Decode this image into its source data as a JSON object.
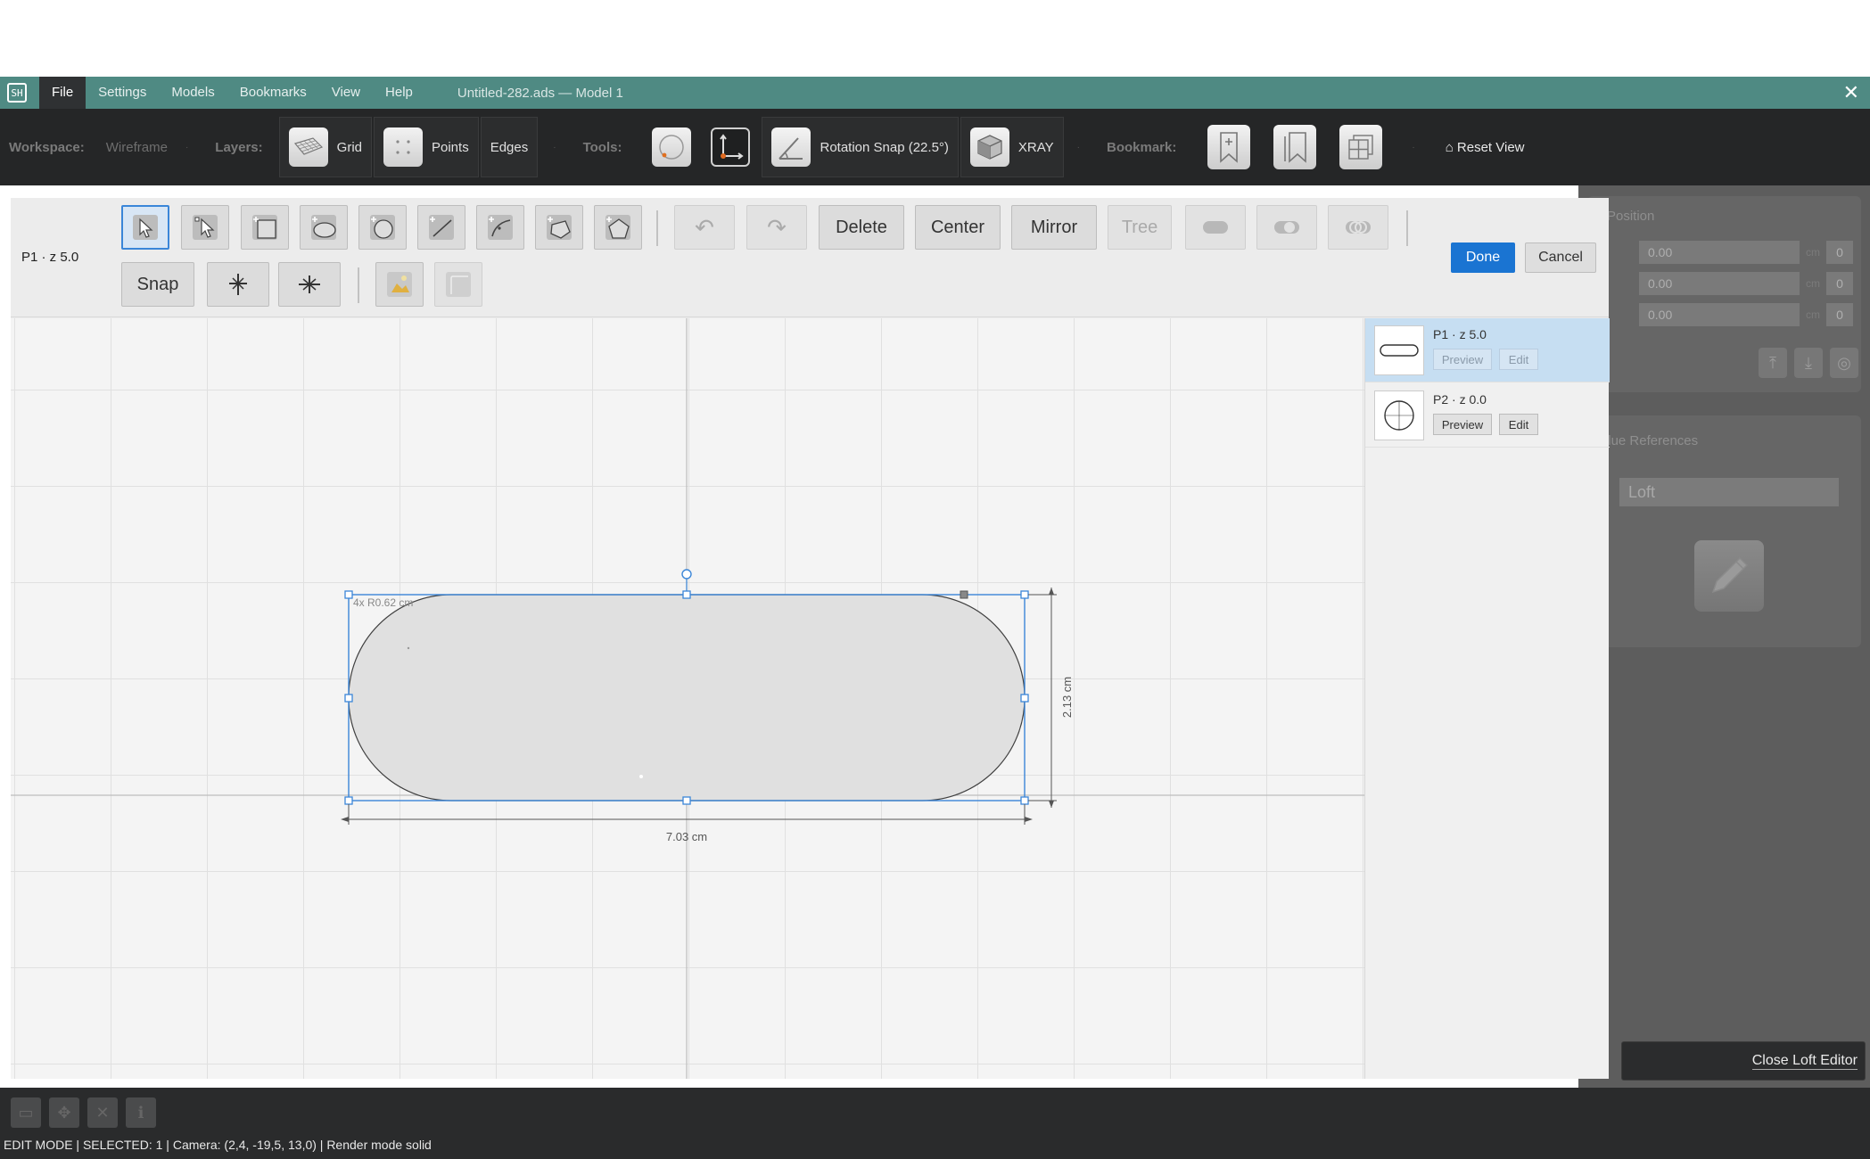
{
  "app": {
    "icon_text": "SH",
    "document_title": "Untitled-282.ads — Model 1",
    "close_glyph": "✕"
  },
  "menu": {
    "items": [
      "File",
      "Settings",
      "Models",
      "Bookmarks",
      "View",
      "Help"
    ],
    "active": "File"
  },
  "toolbar": {
    "workspace_label": "Workspace:",
    "workspace_value": "Wireframe",
    "layers_label": "Layers:",
    "grid_label": "Grid",
    "points_label": "Points",
    "edges_label": "Edges",
    "tools_label": "Tools:",
    "rotation_snap_label": "Rotation Snap (22.5°)",
    "xray_label": "XRAY",
    "bookmark_label": "Bookmark:",
    "reset_view_label": "⌂ Reset View",
    "separator": "·"
  },
  "editor": {
    "layer_label": "P1 · z 5.0",
    "delete_label": "Delete",
    "center_label": "Center",
    "mirror_label": "Mirror",
    "tree_label": "Tree",
    "snap_label": "Snap",
    "done_label": "Done",
    "cancel_label": "Cancel",
    "undo_glyph": "↶",
    "redo_glyph": "↷",
    "canvas": {
      "corner_label": "4x R0.62 cm",
      "width_label": "7.03 cm",
      "height_label": "2.13 cm"
    },
    "layers": [
      {
        "name": "P1 · z 5.0",
        "preview": "Preview",
        "edit": "Edit",
        "shape": "rounded-rect-icon",
        "active": true
      },
      {
        "name": "P2 · z 0.0",
        "preview": "Preview",
        "edit": "Edit",
        "shape": "circle-icon",
        "active": false
      }
    ]
  },
  "right_panel": {
    "position_title": "Position",
    "rows": [
      {
        "value": "0.00",
        "unit": "cm",
        "extra": "0"
      },
      {
        "value": "0.00",
        "unit": "cm",
        "extra": "0"
      },
      {
        "value": "0.00",
        "unit": "cm",
        "extra": "0"
      }
    ],
    "value_references_title": "Value References",
    "loft_label": "Loft",
    "close_loft_label": "Close Loft Editor"
  },
  "status_bar": {
    "text": "EDIT MODE | SELECTED: 1 | Camera: (2,4, -19,5, 13,0) | Render mode solid"
  },
  "colors": {
    "menubar": "#4f8a83",
    "toolbar": "#252627",
    "accent": "#1a74d2",
    "selection": "#3b86d8"
  }
}
